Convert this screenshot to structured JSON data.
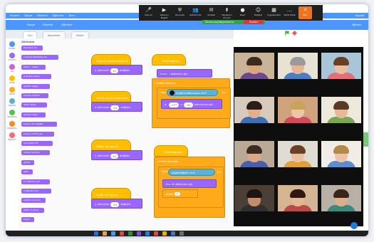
{
  "zoom": {
    "tools": [
      {
        "icon": "mic-icon",
        "label": "Sesi Aç"
      },
      {
        "icon": "video-icon",
        "label": "Videoyu Başlat"
      },
      {
        "icon": "security-icon",
        "label": "Güvenlik"
      },
      {
        "icon": "participants-icon",
        "label": "Katılımcılar"
      },
      {
        "icon": "chat-icon",
        "label": "Sohbet"
      },
      {
        "icon": "share-icon",
        "label": "Paylaşımı Durdur"
      },
      {
        "icon": "record-icon",
        "label": "Kayıt"
      },
      {
        "icon": "reactions-icon",
        "label": "Tepkiler"
      },
      {
        "icon": "apps-icon",
        "label": "Uygulamalar"
      },
      {
        "icon": "more-icon",
        "label": "Daha Fazla"
      },
      {
        "icon": "end-icon",
        "label": "Bitir"
      }
    ],
    "share_status": "Ekranı paylaşıyorsunuz",
    "stop_share": "Durdur"
  },
  "scratch": {
    "menu": [
      "Scratch",
      "Dosya",
      "Düzenle",
      "Eğitimler",
      "Ders"
    ],
    "menu_right": "Kaydet",
    "menu2": [
      "Dosya",
      "Düzenle",
      "Eğitimler"
    ],
    "user": "öğrenci",
    "tabs": [
      "Kod",
      "Kostümler",
      "Sesler"
    ],
    "categories": [
      {
        "label": "Hareket",
        "color": "#4c97ff"
      },
      {
        "label": "Görünüm",
        "color": "#9966ff"
      },
      {
        "label": "Ses",
        "color": "#cf63cf"
      },
      {
        "label": "Olaylar",
        "color": "#ffbf00"
      },
      {
        "label": "Kontrol",
        "color": "#ffab19"
      },
      {
        "label": "Algılama",
        "color": "#5cb1d6"
      },
      {
        "label": "Operatörler",
        "color": "#59c059"
      },
      {
        "label": "Değişkenler",
        "color": "#ff8c1a"
      },
      {
        "label": "Bloklarım",
        "color": "#ff6680"
      }
    ],
    "palette_heading": "Görünüm",
    "palette_blocks": [
      "Merhaba! de",
      "2 saniye Merhaba! de",
      "Hmm... düşün",
      "2 saniye düşün",
      "kostüm değiş",
      "sonraki kostüm",
      "dekor değiş",
      "sonraki dekor",
      "boyutu 10 değiştir",
      "boyutu %100 yap",
      "renk etkisi 25",
      "etkileri temizle",
      "göster",
      "gizle",
      "ön katmana git",
      "1 katman ileri",
      "kostüm numara",
      "dekor numara",
      "boyut"
    ],
    "scripts": {
      "s1": {
        "hat": "Sağ ok tuşuna basılınca",
        "action": "x yönünde",
        "value": "10",
        "tail": "değiştir"
      },
      "s2": {
        "hat": "Sol ok tuşuna basılınca",
        "action": "x yönünde",
        "value": "-10",
        "tail": "değiştir"
      },
      "s3": {
        "hat": "Yukarı ok tuşuna basılınca",
        "action": "y yönünde",
        "value": "10",
        "tail": "değiştir"
      },
      "s4": {
        "hat": "Aşağı ok tuşuna basılınca",
        "action": "y yönünde",
        "value": "-10",
        "tail": "değiştir"
      },
      "s5": {
        "hat": "tıklandığında",
        "look": "dekor 1",
        "lookTail": "dekorunu giy",
        "forever": "sürekli tekrarla",
        "ifLabel": "eğer",
        "sensing": "rengine dokunuyor mu?",
        "thenLabel": "ise",
        "goto": "x:",
        "xval": "-177",
        "ylabel": "y:",
        "yval": "-50",
        "gotoTail": "konumuna git"
      },
      "s6": {
        "hat": "tıklandığında",
        "forever": "sürekli tekrarla",
        "ifLabel": "eğer",
        "sensing": "Apple",
        "sensingTail": "değiyor mu?",
        "thenLabel": "ise",
        "look": "Bas Bü",
        "lookTail": "dekorunu giy",
        "stop": "bekle",
        "stopVal": "2"
      }
    }
  },
  "taskbar_icons": [
    "#2b6bd8",
    "#e8a33d",
    "#39a0e8",
    "#d44a3a",
    "#2a8f3b",
    "#7b4fd0",
    "#1f7ae0",
    "#e0463a",
    "#f2a900",
    "#3c76c8",
    "#6b6b6b"
  ]
}
